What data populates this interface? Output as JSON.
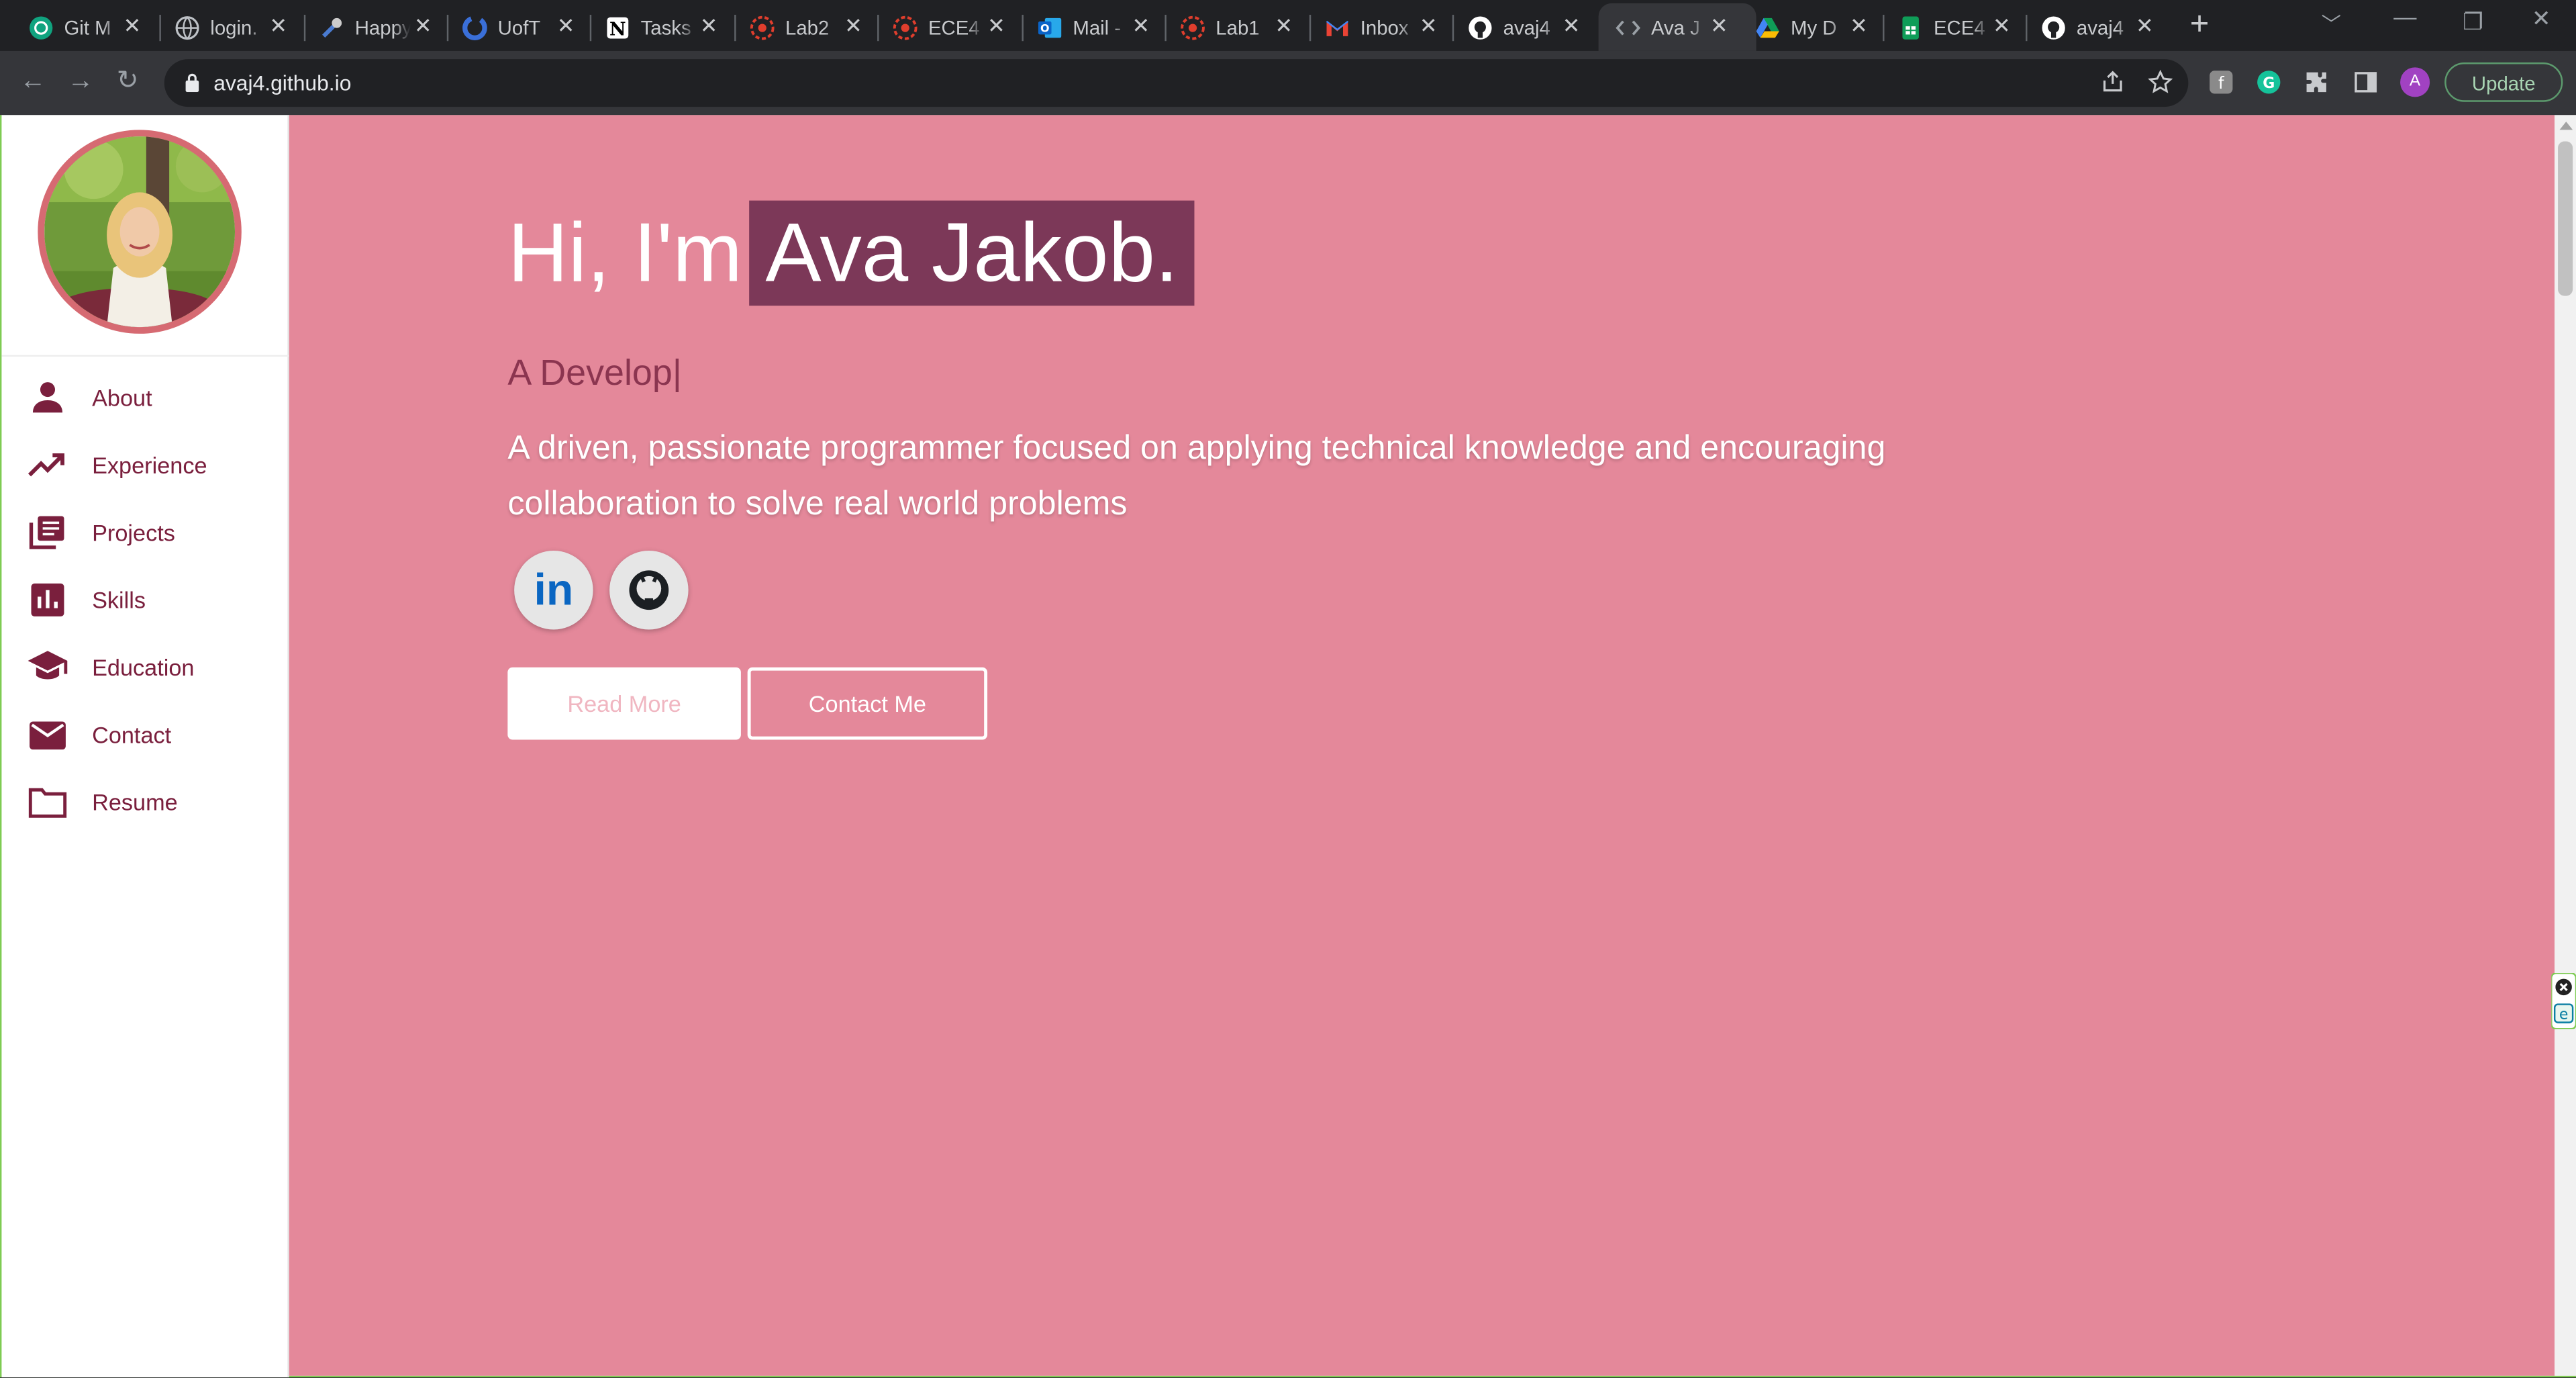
{
  "browser": {
    "tabs": [
      {
        "title": "Git M",
        "icon": "openai-icon",
        "color": "#10a37f"
      },
      {
        "title": "login.",
        "icon": "globe-icon",
        "color": "#bdc1c6"
      },
      {
        "title": "Happy",
        "icon": "tool-icon",
        "color": "#4a7bd0"
      },
      {
        "title": "UofT",
        "icon": "circle-logo-icon",
        "color": "#3a6fd8"
      },
      {
        "title": "Tasks",
        "icon": "notion-icon",
        "color": "#ffffff"
      },
      {
        "title": "Lab2",
        "icon": "quercus-icon",
        "color": "#e03e2d"
      },
      {
        "title": "ECE4",
        "icon": "quercus-icon",
        "color": "#e03e2d"
      },
      {
        "title": "Mail -",
        "icon": "outlook-icon",
        "color": "#0a64c8"
      },
      {
        "title": "Lab1",
        "icon": "quercus-icon",
        "color": "#e03e2d"
      },
      {
        "title": "Inbox",
        "icon": "gmail-icon",
        "color": "#ea4335"
      },
      {
        "title": "avaj4",
        "icon": "github-icon",
        "color": "#ffffff"
      },
      {
        "title": "Ava J",
        "icon": "code-icon",
        "color": "#9aa0a6",
        "active": true
      },
      {
        "title": "My D",
        "icon": "drive-icon",
        "color": "#fbbc04"
      },
      {
        "title": "ECE4",
        "icon": "sheets-icon",
        "color": "#0f9d58"
      },
      {
        "title": "avaj4",
        "icon": "github-icon",
        "color": "#ffffff"
      }
    ],
    "close_glyph": "✕",
    "new_tab": "+",
    "url": "avaj4.github.io",
    "update_label": "Update",
    "profile_initial": "A"
  },
  "sidebar": {
    "items": [
      {
        "label": "About",
        "icon": "person-icon"
      },
      {
        "label": "Experience",
        "icon": "trending-up-icon"
      },
      {
        "label": "Projects",
        "icon": "library-icon"
      },
      {
        "label": "Skills",
        "icon": "bar-chart-icon"
      },
      {
        "label": "Education",
        "icon": "graduation-cap-icon"
      },
      {
        "label": "Contact",
        "icon": "mail-icon"
      },
      {
        "label": "Resume",
        "icon": "folder-icon"
      }
    ]
  },
  "hero": {
    "greeting": "Hi, I'm",
    "name": "Ava Jakob.",
    "typed": "A Develop|",
    "description": "A driven, passionate programmer focused on applying technical knowledge and encouraging collaboration to solve real world problems",
    "linkedin": "in",
    "read_more": "Read More",
    "contact_me": "Contact Me"
  },
  "colors": {
    "hero_bg": "#e4889a",
    "name_highlight": "#7c3858",
    "accent": "#7a1f3d"
  }
}
